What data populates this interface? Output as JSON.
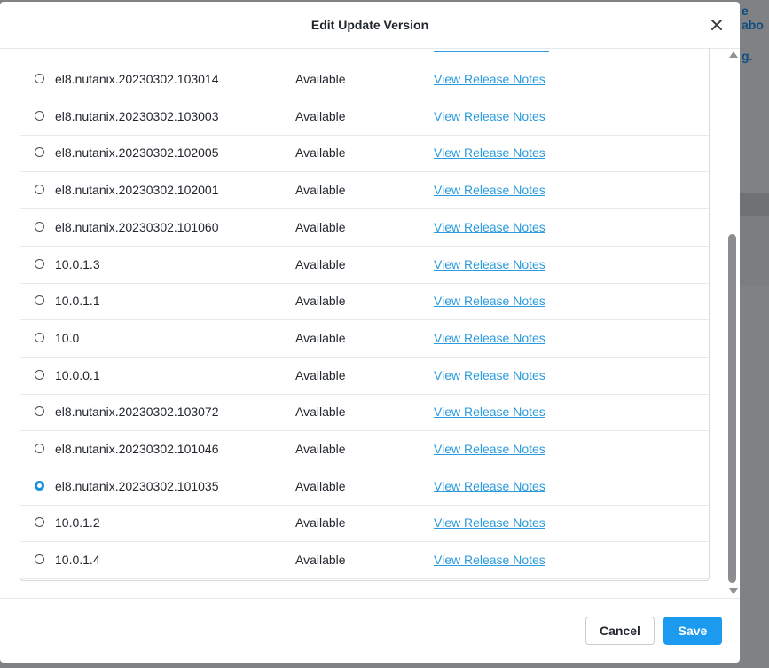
{
  "background": {
    "text_fragment_1": "e abo",
    "text_fragment_2": "g."
  },
  "modal": {
    "title": "Edit Update Version",
    "close_icon": "close-icon"
  },
  "table": {
    "rows": [
      {
        "version": "el8.nutanix.20230302.103014",
        "status": "Available",
        "notes": "View Release Notes",
        "selected": false
      },
      {
        "version": "el8.nutanix.20230302.103003",
        "status": "Available",
        "notes": "View Release Notes",
        "selected": false
      },
      {
        "version": "el8.nutanix.20230302.102005",
        "status": "Available",
        "notes": "View Release Notes",
        "selected": false
      },
      {
        "version": "el8.nutanix.20230302.102001",
        "status": "Available",
        "notes": "View Release Notes",
        "selected": false
      },
      {
        "version": "el8.nutanix.20230302.101060",
        "status": "Available",
        "notes": "View Release Notes",
        "selected": false
      },
      {
        "version": "10.0.1.3",
        "status": "Available",
        "notes": "View Release Notes",
        "selected": false
      },
      {
        "version": "10.0.1.1",
        "status": "Available",
        "notes": "View Release Notes",
        "selected": false
      },
      {
        "version": "10.0",
        "status": "Available",
        "notes": "View Release Notes",
        "selected": false
      },
      {
        "version": "10.0.0.1",
        "status": "Available",
        "notes": "View Release Notes",
        "selected": false
      },
      {
        "version": "el8.nutanix.20230302.103072",
        "status": "Available",
        "notes": "View Release Notes",
        "selected": false
      },
      {
        "version": "el8.nutanix.20230302.101046",
        "status": "Available",
        "notes": "View Release Notes",
        "selected": false
      },
      {
        "version": "el8.nutanix.20230302.101035",
        "status": "Available",
        "notes": "View Release Notes",
        "selected": true
      },
      {
        "version": "10.0.1.2",
        "status": "Available",
        "notes": "View Release Notes",
        "selected": false
      },
      {
        "version": "10.0.1.4",
        "status": "Available",
        "notes": "View Release Notes",
        "selected": false
      }
    ]
  },
  "footer": {
    "cancel_label": "Cancel",
    "save_label": "Save"
  },
  "colors": {
    "accent": "#1b9af0",
    "link": "#2a9bdc",
    "overlay": "#808184"
  }
}
